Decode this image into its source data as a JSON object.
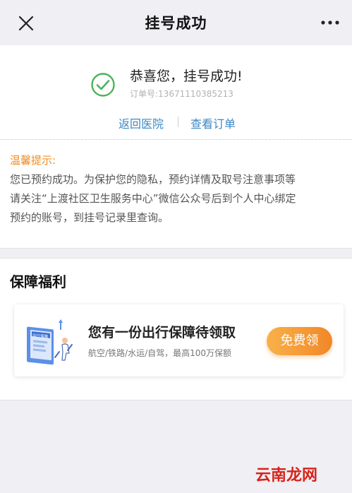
{
  "header": {
    "title": "挂号成功"
  },
  "result": {
    "title": "恭喜您，挂号成功!",
    "order_label": "订单号:13671110385213"
  },
  "links": {
    "back_hospital": "返回医院",
    "view_order": "查看订单"
  },
  "tips": {
    "title": "温馨提示:",
    "lines": [
      "您已预约成功。为保护您的隐私，预约详情及取号注意事项等",
      "请关注“上渡社区卫生服务中心”微信公众号后到个人中心绑定",
      "预约的账号，到挂号记录里查询。"
    ]
  },
  "welfare": {
    "section_title": "保障福利",
    "card": {
      "title": "您有一份出行保障待领取",
      "subtitle": "航空/铁路/水运/自驾，最高100万保额",
      "button": "免费领",
      "illustration_text": "出行保障"
    }
  },
  "watermark": "云南龙网",
  "colors": {
    "accent_link": "#3b88c4",
    "success": "#4cb25c",
    "tips_title": "#f08c1e",
    "button_start": "#f9b14a",
    "button_end": "#f18727",
    "watermark": "#d8231a"
  }
}
